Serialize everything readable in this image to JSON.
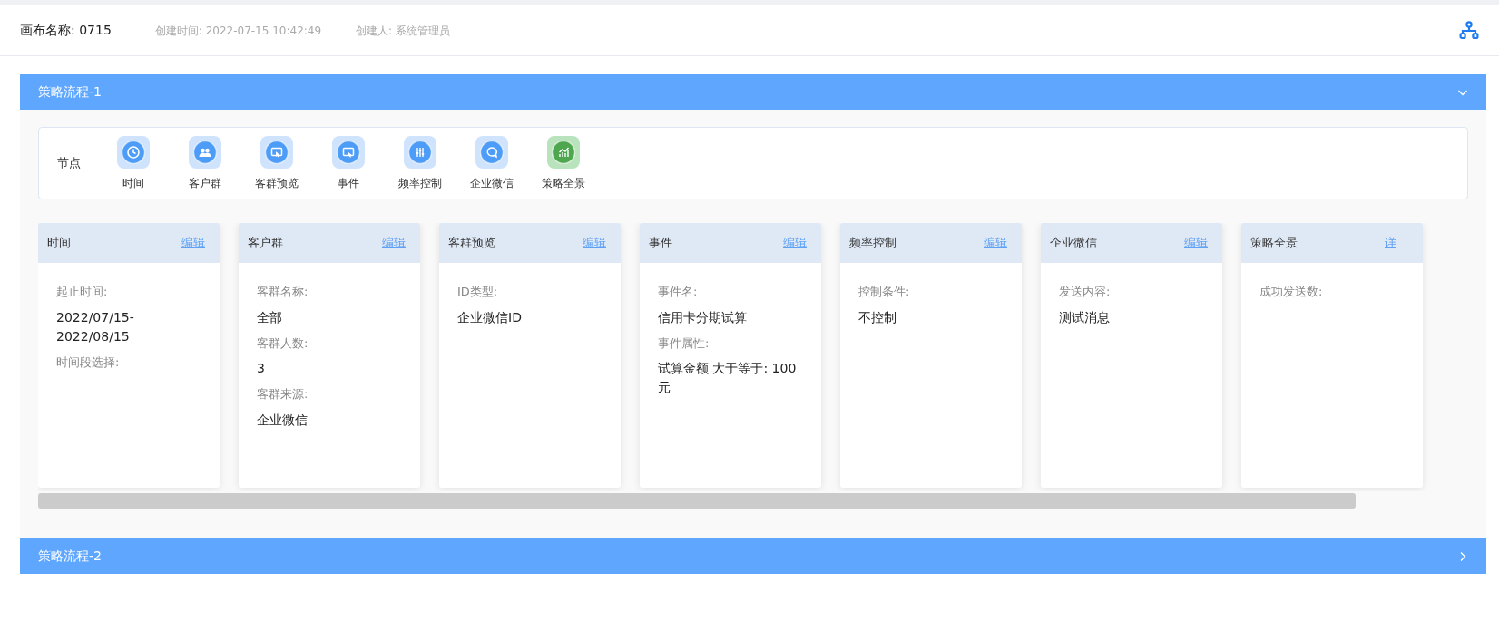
{
  "header": {
    "canvas_name": "画布名称: 0715",
    "created_time": "创建时间: 2022-07-15 10:42:49",
    "creator": "创建人: 系统管理员"
  },
  "panels": [
    {
      "title": "策略流程-1",
      "expanded": true,
      "node_bar": {
        "label": "节点",
        "nodes": [
          "时间",
          "客户群",
          "客群预览",
          "事件",
          "频率控制",
          "企业微信",
          "策略全景"
        ]
      },
      "cards": [
        {
          "title": "时间",
          "action": "编辑",
          "fields": [
            {
              "label": "起止时间:",
              "value": "2022/07/15-2022/08/15"
            },
            {
              "label": "时间段选择:"
            }
          ]
        },
        {
          "title": "客户群",
          "action": "编辑",
          "fields": [
            {
              "label": "客群名称:",
              "value": "全部"
            },
            {
              "label": "客群人数:",
              "value": "3"
            },
            {
              "label": "客群来源:",
              "value": "企业微信"
            }
          ]
        },
        {
          "title": "客群预览",
          "action": "编辑",
          "fields": [
            {
              "label": "ID类型:",
              "value": "企业微信ID"
            }
          ]
        },
        {
          "title": "事件",
          "action": "编辑",
          "fields": [
            {
              "label": "事件名:",
              "value": "信用卡分期试算"
            },
            {
              "label": "事件属性:",
              "value": "试算金额 大于等于: 100元"
            }
          ]
        },
        {
          "title": "频率控制",
          "action": "编辑",
          "fields": [
            {
              "label": "控制条件:",
              "value": "不控制"
            }
          ]
        },
        {
          "title": "企业微信",
          "action": "编辑",
          "fields": [
            {
              "label": "发送内容:",
              "value": "测试消息"
            }
          ]
        },
        {
          "title": "策略全景",
          "action": "详",
          "fields": [
            {
              "label": "成功发送数:"
            }
          ]
        }
      ]
    },
    {
      "title": "策略流程-2",
      "expanded": false
    }
  ]
}
